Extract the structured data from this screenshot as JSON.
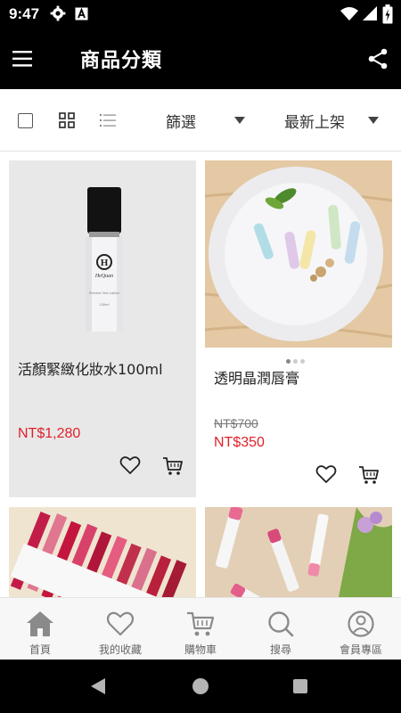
{
  "status_bar": {
    "time": "9:47",
    "icons": [
      "gear-icon",
      "a-badge-icon",
      "wifi-icon",
      "signal-icon",
      "battery-icon"
    ]
  },
  "app_bar": {
    "title": "商品分類",
    "menu_icon": "hamburger-icon",
    "share_icon": "share-icon"
  },
  "toolbar": {
    "filter_label": "篩選",
    "sort_label": "最新上架"
  },
  "products": [
    {
      "name": "活顏緊緻化妝水100ml",
      "price": "NT$1,280",
      "bottle_brand": "HeQuan",
      "bottle_line1": "Prevent Skin Lotion",
      "bottle_line2": "100ml"
    },
    {
      "name": "透明晶潤唇膏",
      "original_price": "NT$700",
      "price": "NT$350"
    },
    {},
    {}
  ],
  "bottom_nav": {
    "items": [
      {
        "label": "首頁",
        "icon": "home-icon"
      },
      {
        "label": "我的收藏",
        "icon": "heart-icon"
      },
      {
        "label": "購物車",
        "icon": "cart-icon"
      },
      {
        "label": "搜尋",
        "icon": "search-icon"
      },
      {
        "label": "會員專區",
        "icon": "user-icon"
      }
    ]
  },
  "colors": {
    "header_bg": "#000000",
    "price_red": "#e0202a",
    "card_gray": "#e8e8e8",
    "nav_bg": "#f7f7f7"
  }
}
